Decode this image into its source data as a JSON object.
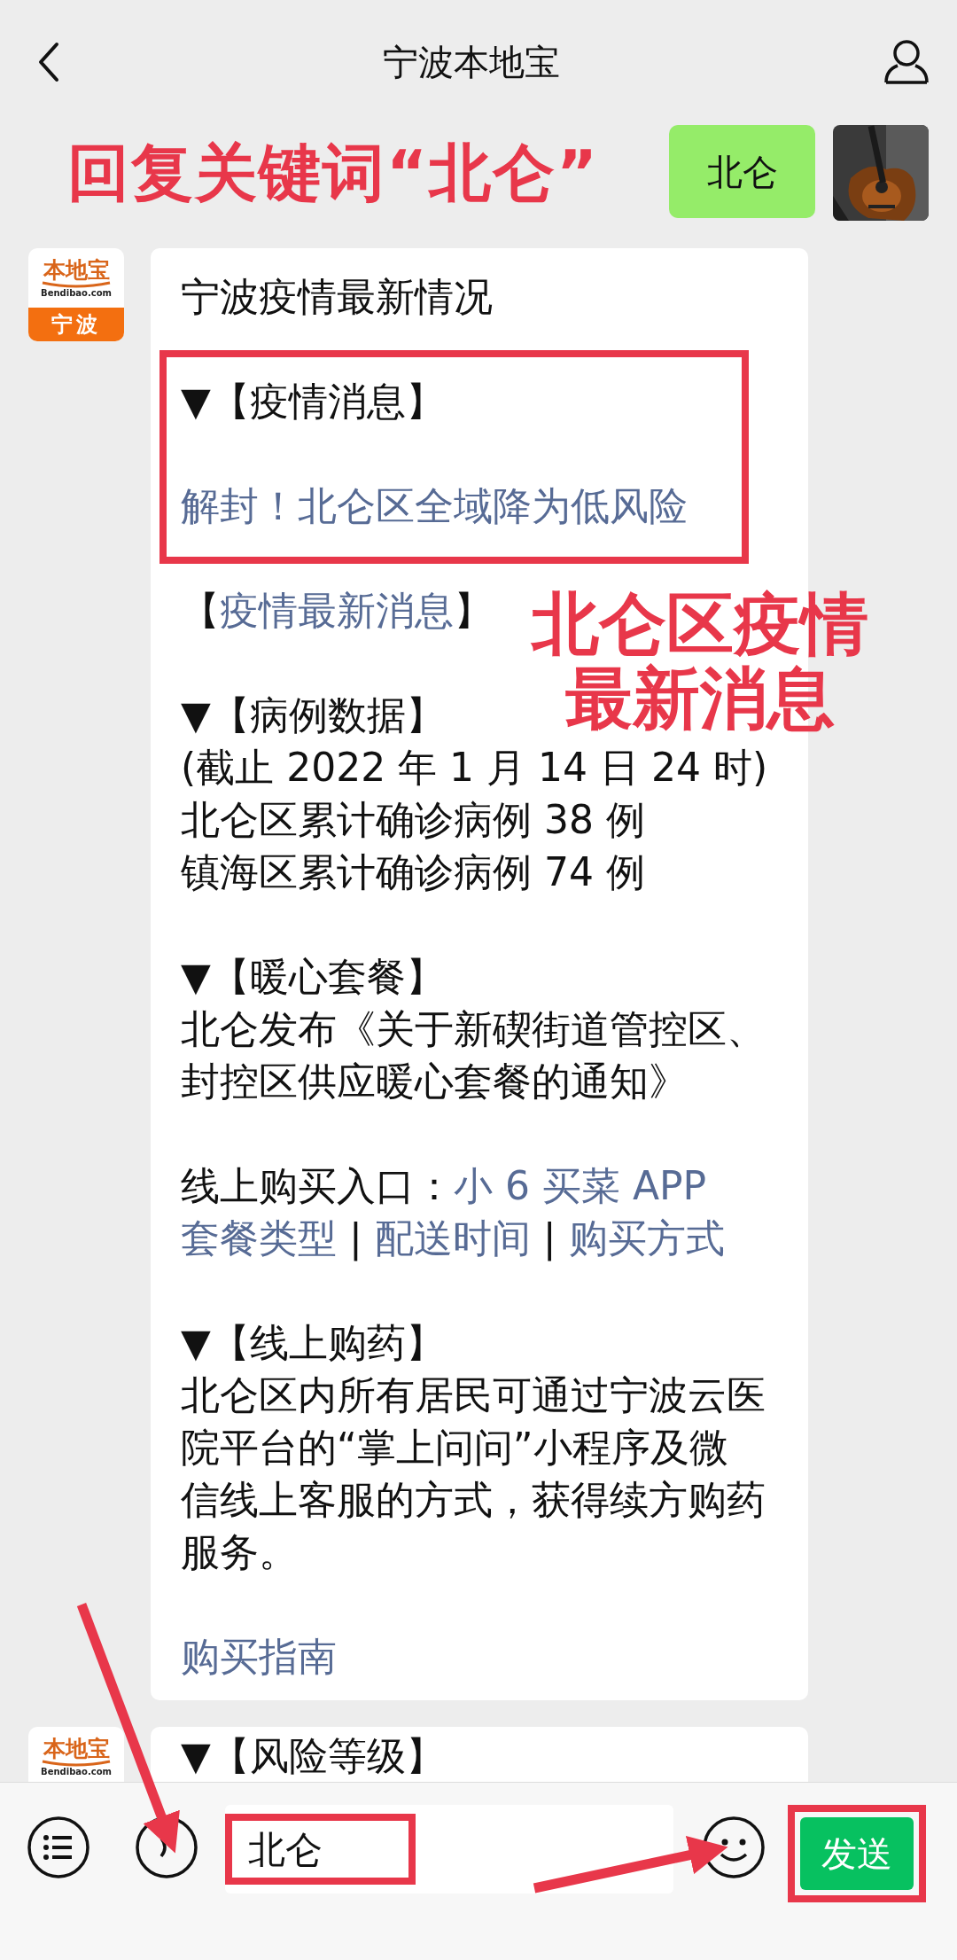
{
  "header": {
    "title": "宁波本地宝"
  },
  "annotation": {
    "text": "回复关键词“北仑”"
  },
  "messages": [
    {
      "kind": "outgoing",
      "text": "北仑"
    },
    {
      "kind": "incoming",
      "avatar": {
        "brand": "本地宝",
        "site": "Bendibao.com",
        "city": "宁波"
      },
      "blocks": [
        {
          "kind": "plain",
          "paragraphs": [
            {
              "lines": [
                [
                  {
                    "kind": "text",
                    "text": "宁波疫情最新情况"
                  }
                ]
              ]
            }
          ]
        },
        {
          "kind": "boxed",
          "paragraphs": [
            {
              "lines": [
                [
                  {
                    "kind": "text",
                    "text": "▼【疫情消息】"
                  }
                ]
              ]
            },
            {
              "lines": [
                [
                  {
                    "kind": "link",
                    "text": "解封！北仑区全域降为低风险"
                  }
                ]
              ]
            }
          ]
        },
        {
          "kind": "plain",
          "paragraphs": [
            {
              "lines": [
                [
                  {
                    "kind": "text",
                    "text": "【"
                  },
                  {
                    "kind": "link",
                    "text": "疫情最新消息"
                  },
                  {
                    "kind": "text",
                    "text": "】"
                  }
                ]
              ]
            },
            {
              "lines": [
                [
                  {
                    "kind": "text",
                    "text": "▼【病例数据】"
                  }
                ],
                [
                  {
                    "kind": "text",
                    "text": "(截止 2022 年 1 月 14 日 24 时)"
                  }
                ],
                [
                  {
                    "kind": "text",
                    "text": "北仑区累计确诊病例 38 例"
                  }
                ],
                [
                  {
                    "kind": "text",
                    "text": "镇海区累计确诊病例 74 例"
                  }
                ]
              ]
            },
            {
              "lines": [
                [
                  {
                    "kind": "text",
                    "text": "▼【暖心套餐】"
                  }
                ],
                [
                  {
                    "kind": "text",
                    "text": "北仑发布《关于新碶街道管控区、"
                  }
                ],
                [
                  {
                    "kind": "text",
                    "text": "封控区供应暖心套餐的通知》"
                  }
                ]
              ]
            },
            {
              "lines": [
                [
                  {
                    "kind": "text",
                    "text": "线上购买入口："
                  },
                  {
                    "kind": "link",
                    "text": "小 6 买菜 APP"
                  }
                ],
                [
                  {
                    "kind": "link",
                    "text": "套餐类型"
                  },
                  {
                    "kind": "text",
                    "text": " | "
                  },
                  {
                    "kind": "link",
                    "text": "配送时间"
                  },
                  {
                    "kind": "text",
                    "text": " | "
                  },
                  {
                    "kind": "link",
                    "text": "购买方式"
                  }
                ]
              ]
            },
            {
              "lines": [
                [
                  {
                    "kind": "text",
                    "text": "▼【线上购药】"
                  }
                ],
                [
                  {
                    "kind": "text",
                    "text": "北仑区内所有居民可通过宁波云医"
                  }
                ],
                [
                  {
                    "kind": "text",
                    "text": "院平台的“掌上问问”小程序及微"
                  }
                ],
                [
                  {
                    "kind": "text",
                    "text": "信线上客服的方式，获得续方购药"
                  }
                ],
                [
                  {
                    "kind": "text",
                    "text": "服务。"
                  }
                ]
              ]
            },
            {
              "lines": [
                [
                  {
                    "kind": "link",
                    "text": "购买指南"
                  }
                ]
              ]
            }
          ]
        }
      ]
    },
    {
      "kind": "incoming",
      "avatar": {
        "brand": "本地宝",
        "site": "Bendibao.com"
      },
      "blocks": [
        {
          "kind": "plain",
          "paragraphs": [
            {
              "lines": [
                [
                  {
                    "kind": "text",
                    "text": "▼【风险等级】"
                  }
                ]
              ]
            }
          ]
        }
      ]
    }
  ],
  "overlay_note": {
    "lines": [
      "北仑区疫情",
      "最新消息"
    ]
  },
  "composer": {
    "value": "北仑",
    "value_annotated": true,
    "send_label": "发送",
    "send_annotated": true
  }
}
